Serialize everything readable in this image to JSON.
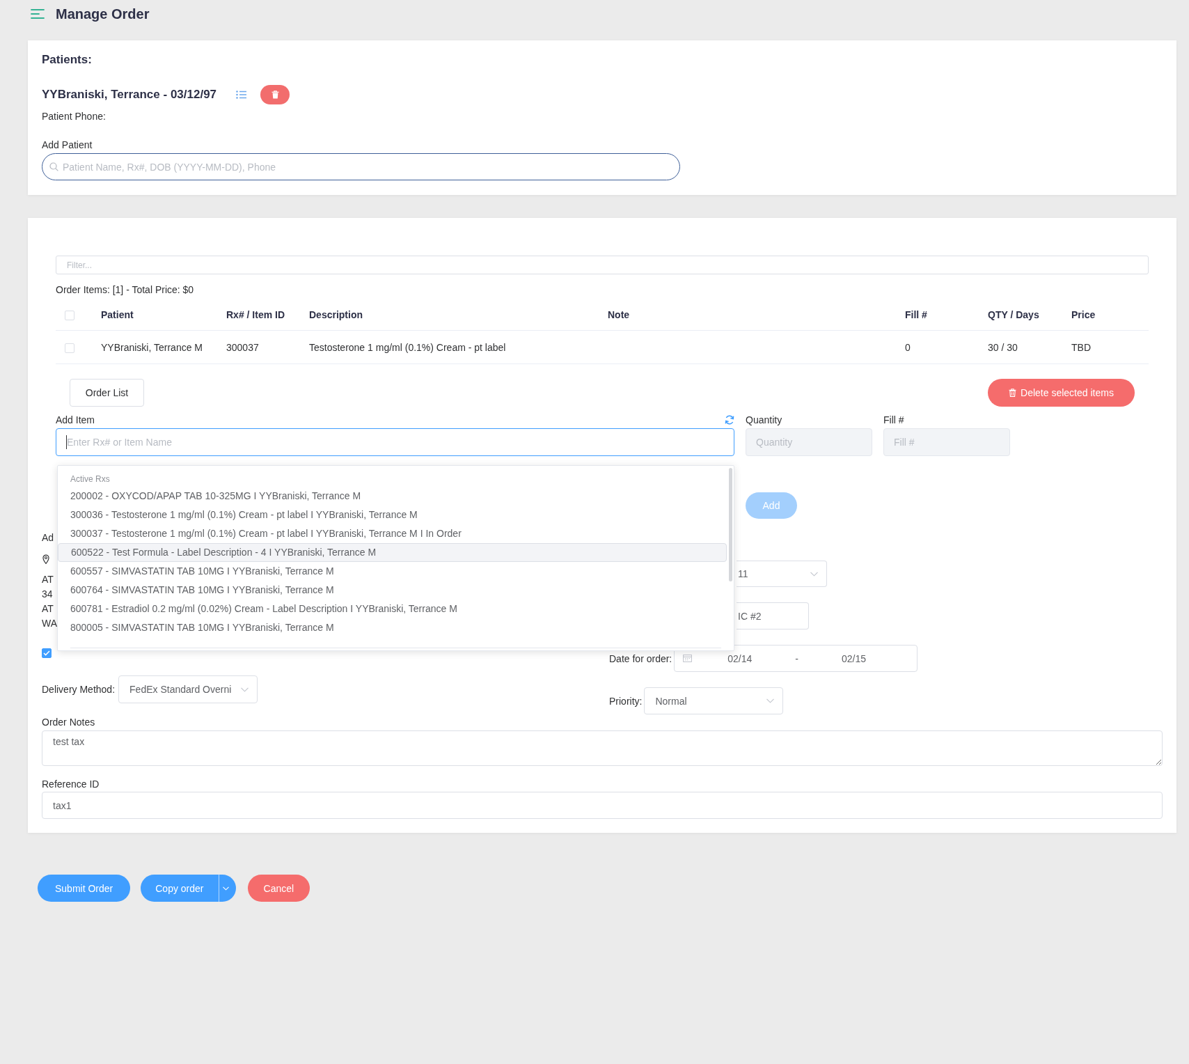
{
  "header": {
    "title": "Manage Order"
  },
  "patients": {
    "heading": "Patients:",
    "patient": {
      "name": "YYBraniski, Terrance - 03/12/97",
      "phone_label": "Patient Phone:"
    },
    "add_patient": {
      "label": "Add Patient",
      "placeholder": "Patient Name, Rx#, DOB (YYYY-MM-DD), Phone"
    }
  },
  "order": {
    "filter": {
      "placeholder": "Filter..."
    },
    "summary": "Order Items: [1] - Total Price: $0",
    "table": {
      "select_all": {
        "checked": false
      },
      "columns": [
        "Patient",
        "Rx# / Item ID",
        "Description",
        "Note",
        "Fill #",
        "QTY / Days",
        "Price"
      ],
      "rows": [
        {
          "checked": false,
          "patient": "YYBraniski, Terrance M",
          "rx_item_id": "300037",
          "description": "Testosterone 1 mg/ml (0.1%) Cream - pt label",
          "fill": "0",
          "qty_days": "30 / 30",
          "price": "TBD"
        }
      ]
    },
    "order_list_button": "Order List",
    "delete_selected_button": "Delete selected items",
    "add_item": {
      "label": "Add Item",
      "placeholder": "Enter Rx# or Item Name",
      "focused": true
    },
    "quantity": {
      "label": "Quantity",
      "placeholder": "Quantity",
      "disabled": true
    },
    "fill": {
      "label": "Fill #",
      "placeholder": "Fill #",
      "disabled": true
    },
    "add_button": {
      "label": "Add",
      "disabled": true
    },
    "suggestions": {
      "group": "Active Rxs",
      "items": [
        {
          "text": "200002 - OXYCOD/APAP TAB 10-325MG I YYBraniski, Terrance M",
          "selected": false
        },
        {
          "text": "300036 - Testosterone 1 mg/ml (0.1%) Cream - pt label I YYBraniski, Terrance M",
          "selected": false
        },
        {
          "text": "300037 - Testosterone 1 mg/ml (0.1%) Cream - pt label I YYBraniski, Terrance M I In Order",
          "selected": false
        },
        {
          "text": "600522 - Test Formula - Label Description - 4 I YYBraniski, Terrance M",
          "selected": true
        },
        {
          "text": "600557 - SIMVASTATIN TAB 10MG I YYBraniski, Terrance M",
          "selected": false
        },
        {
          "text": "600764 - SIMVASTATIN TAB 10MG I YYBraniski, Terrance M",
          "selected": false
        },
        {
          "text": "600781 - Estradiol 0.2 mg/ml (0.02%) Cream - Label Description I YYBraniski, Terrance M",
          "selected": false
        },
        {
          "text": "800005 - SIMVASTATIN TAB 10MG I YYBraniski, Terrance M",
          "selected": false
        }
      ]
    },
    "address": {
      "label": "Ad",
      "lines": [
        "AT",
        "34",
        "AT",
        "WA"
      ]
    },
    "confirm_checkbox": {
      "checked": true
    },
    "delivery_method": {
      "label": "Delivery Method:",
      "value": "FedEx Standard Overni"
    },
    "covered_select": {
      "value": "11"
    },
    "covered_input": {
      "value": "IC #2"
    },
    "date_for_order": {
      "label": "Date for order:",
      "start": "02/14",
      "separator": "-",
      "end": "02/15"
    },
    "priority": {
      "label": "Priority:",
      "value": "Normal"
    },
    "order_notes": {
      "label": "Order Notes",
      "value": "test tax"
    },
    "reference_id": {
      "label": "Reference ID",
      "value": "tax1"
    }
  },
  "actions": [
    {
      "label": "Submit Order",
      "kind": "primary"
    },
    {
      "label": "Copy order",
      "kind": "split"
    },
    {
      "label": "Cancel",
      "kind": "danger"
    }
  ]
}
